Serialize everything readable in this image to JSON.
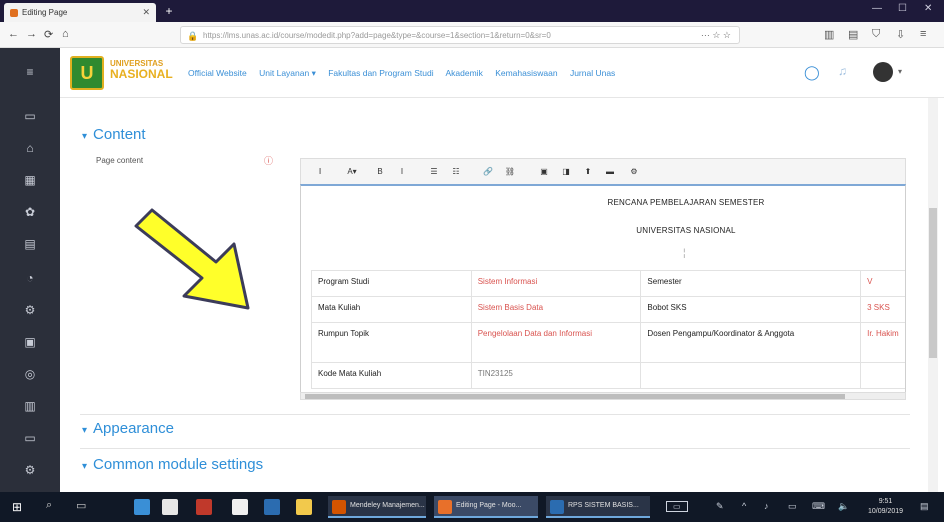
{
  "browser": {
    "tab_title": "Editing Page",
    "new_tab": "+",
    "url": "https://lms.unas.ac.id/course/modedit.php?add=page&type=&course=1&section=1&return=0&sr=0",
    "url_more": "··· ☆ ☆",
    "win_minimize": "—",
    "win_maximize": "☐",
    "win_close": "✕",
    "back": "←",
    "forward": "→",
    "reload": "⟳",
    "home": "⌂",
    "toolbar_icons": [
      "library-icon",
      "reader-icon",
      "shield-icon",
      "download-icon",
      "menu-icon"
    ]
  },
  "site": {
    "logo_glyph": "U",
    "logo_line1": "UNIVERSITAS",
    "logo_line2": "NASIONAL",
    "nav": [
      "Official Website",
      "Unit Layanan ▾",
      "Fakultas dan Program Studi",
      "Akademik",
      "Kemahasiswaan",
      "Jurnal Unas"
    ],
    "chat_icon": "◯",
    "bell_icon": "🔔",
    "caret": "▾"
  },
  "main": {
    "content_section": "Content",
    "page_content_label": "Page content",
    "required_mark": "ⓘ",
    "appearance_section": "Appearance",
    "common_section": "Common module settings",
    "section_caret": "▾"
  },
  "editor": {
    "toolbar": [
      "Ⅰ",
      "A▾",
      "B",
      "I",
      "☰",
      "☷",
      "🔗",
      "⛓",
      "▣",
      "◨",
      "⬆",
      "▬",
      "⚙"
    ],
    "doc_title": "RENCANA PEMBELAJARAN SEMESTER",
    "doc_subtitle": "UNIVERSITAS NASIONAL",
    "cursor": "¦",
    "rows": [
      {
        "label": "Program Studi",
        "value": "Sistem Informasi",
        "label2": "Semester",
        "value2": "V"
      },
      {
        "label": "Mata Kuliah",
        "value": "Sistem Basis Data",
        "label2": "Bobot SKS",
        "value2": "3 SKS"
      },
      {
        "label": "Rumpun Topik",
        "value": "Pengelolaan Data dan Informasi",
        "label2": "Dosen Pengampu/Koordinator & Anggota",
        "value2": "Ir. Hakim"
      },
      {
        "label": "Kode Mata Kuliah",
        "value": "TIN23125",
        "label2": "",
        "value2": ""
      }
    ]
  },
  "taskbar": {
    "apps": [
      "Mendeley Manajemen...",
      "Editing Page - Moo...",
      "RPS SISTEM BASIS..."
    ],
    "tray": [
      "^",
      "♪",
      "▭",
      "⌨",
      "🔈"
    ],
    "time": "9:51",
    "date": "10/09/2019",
    "battery_label": "▭"
  },
  "colors": {
    "accent": "#2f8fd8",
    "required": "#d9534f",
    "rail": "#2b2f3a",
    "arrow": "#ffff2a"
  }
}
